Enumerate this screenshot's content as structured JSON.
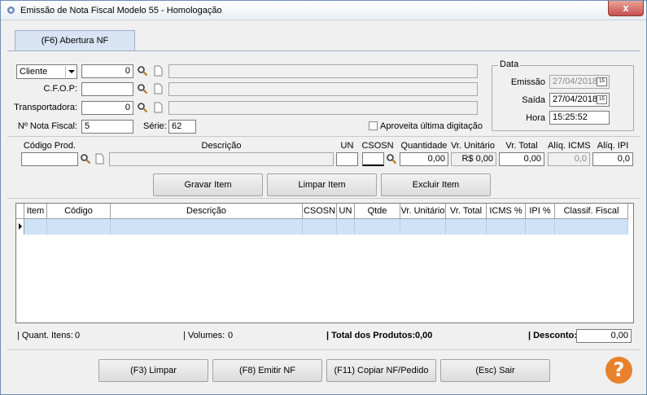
{
  "window": {
    "title": "Emissão de Nota Fiscal Modelo 55 - Homologação",
    "close_label": "x"
  },
  "tabs": [
    {
      "label": "(F6) Abertura NF",
      "active": true
    }
  ],
  "header": {
    "tipo_select": "Cliente",
    "cliente_code": "0",
    "cliente_name": "",
    "cfop_label": "C.F.O.P:",
    "cfop_code": "",
    "cfop_desc": "",
    "transportadora_label": "Transportadora:",
    "transportadora_code": "0",
    "transportadora_name": "",
    "nota_fiscal_label": "Nº Nota Fiscal:",
    "nota_fiscal_value": "5",
    "serie_label": "Série:",
    "serie_value": "62",
    "aproveita_label": "Aproveita última digitação",
    "aproveita_checked": false
  },
  "data_group": {
    "title": "Data",
    "emissao_label": "Emissão",
    "emissao_value": "27/04/2018",
    "saida_label": "Saída",
    "saida_value": "27/04/2018",
    "hora_label": "Hora",
    "hora_value": "15:25:52",
    "calendar_glyph": "15"
  },
  "item_entry": {
    "codigo_label": "Código Prod.",
    "codigo_value": "",
    "descricao_label": "Descrição",
    "descricao_value": "",
    "un_label": "UN",
    "un_value": "",
    "csosn_label": "CSOSN",
    "csosn_value": "",
    "quantidade_label": "Quantidade",
    "quantidade_value": "0,00",
    "vr_unitario_label": "Vr. Unitário",
    "vr_unitario_value": "R$ 0,00",
    "vr_total_label": "Vr. Total",
    "vr_total_value": "0,00",
    "aliq_icms_label": "Alíq. ICMS",
    "aliq_icms_value": "0,0",
    "aliq_ipi_label": "Alíq. IPI",
    "aliq_ipi_value": "0,0"
  },
  "item_buttons": {
    "gravar": "Gravar Item",
    "limpar": "Limpar Item",
    "excluir": "Excluir Item"
  },
  "grid": {
    "columns": [
      "Item",
      "Código",
      "Descrição",
      "CSOSN",
      "UN",
      "Qtde",
      "Vr. Unitário",
      "Vr. Total",
      "ICMS %",
      "IPI %",
      "Classif. Fiscal"
    ],
    "rows": []
  },
  "totals": {
    "quant_itens_label": "| Quant. Itens:",
    "quant_itens_value": "0",
    "volumes_label": "| Volumes:",
    "volumes_value": "0",
    "total_produtos_label": "| Total dos Produtos:",
    "total_produtos_value": "0,00",
    "desconto_label": "| Desconto:",
    "desconto_value": "0,00"
  },
  "bottom_buttons": {
    "limpar": "(F3) Limpar",
    "emitir": "(F8) Emitir NF",
    "copiar": "(F11) Copiar NF/Pedido",
    "sair": "(Esc) Sair"
  },
  "help_glyph": "?",
  "colors": {
    "tab_bg": "#d8e4f3",
    "selected_row": "#cfe2f7",
    "help_button": "#e8812b",
    "close_button": "#c75050"
  }
}
